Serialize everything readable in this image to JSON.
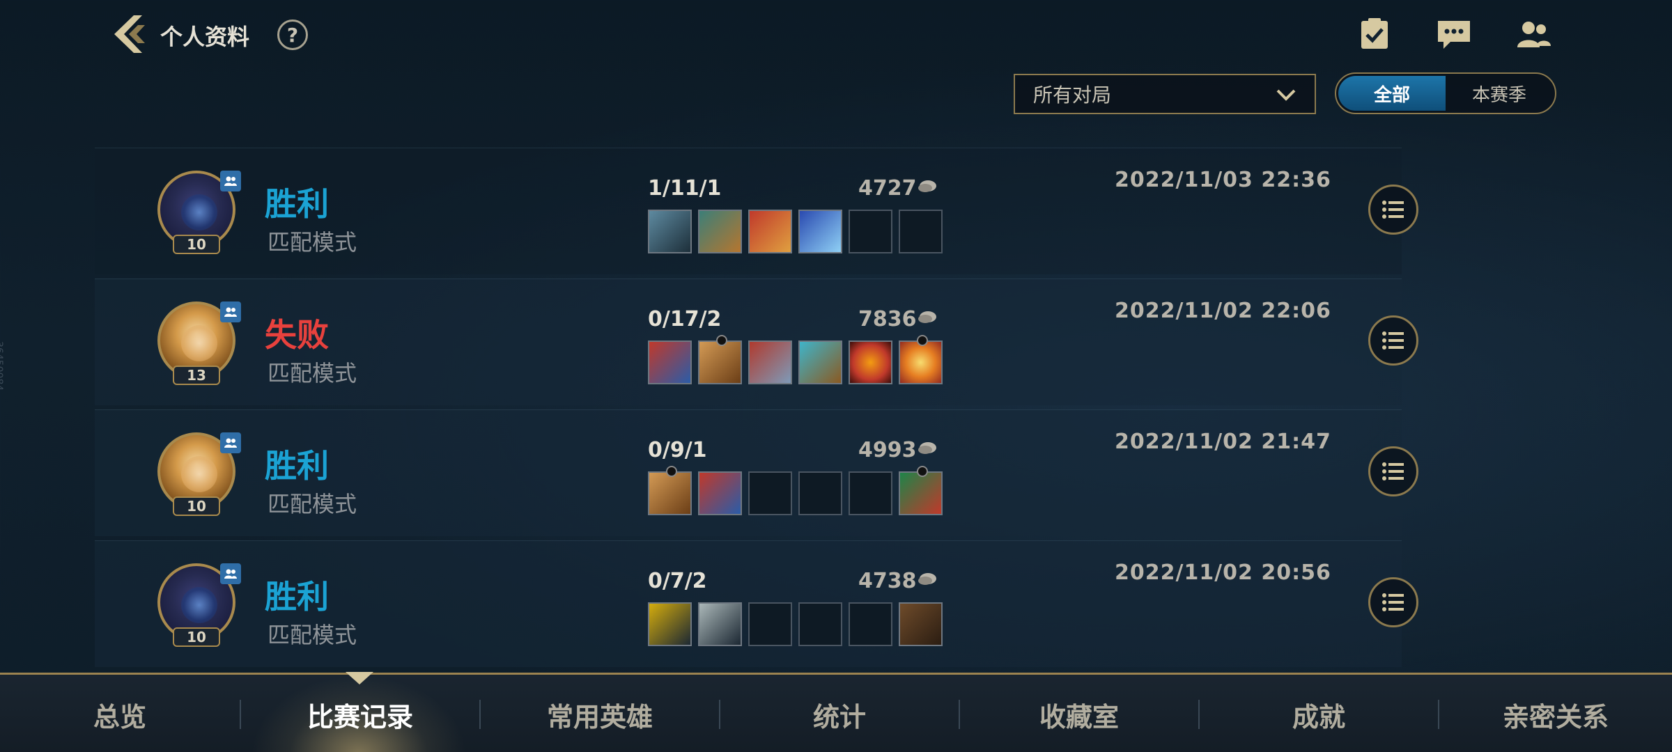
{
  "header": {
    "title": "个人资料",
    "help_label": "?",
    "icons": [
      "checklist-icon",
      "chat-icon",
      "friends-icon"
    ]
  },
  "filters": {
    "mode_select_value": "所有对局",
    "toggle": [
      {
        "label": "全部",
        "active": true
      },
      {
        "label": "本赛季",
        "active": false
      }
    ]
  },
  "side_id": "36450084",
  "matches": [
    {
      "result": "胜利",
      "result_type": "win",
      "mode": "匹配模式",
      "level": "10",
      "hero": "hero-a",
      "kda": "1/11/1",
      "gold": "4727",
      "time": "2022/11/03 22:36",
      "items": [
        "sword-item",
        "axe-item",
        "blade-item",
        "crystal-sword-item",
        "",
        ""
      ]
    },
    {
      "result": "失败",
      "result_type": "loss",
      "mode": "匹配模式",
      "level": "13",
      "hero": "hero-b",
      "kda": "0/17/2",
      "gold": "7836",
      "time": "2022/11/02 22:06",
      "items": [
        "shield-item",
        "buckler-item",
        "wings-item",
        "armor-item",
        "potion-item",
        "star-item"
      ]
    },
    {
      "result": "胜利",
      "result_type": "win",
      "mode": "匹配模式",
      "level": "10",
      "hero": "hero-b",
      "kda": "0/9/1",
      "gold": "4993",
      "time": "2022/11/02 21:47",
      "items": [
        "buckler-item",
        "shield-item",
        "",
        "",
        "",
        "boots-item"
      ]
    },
    {
      "result": "胜利",
      "result_type": "win",
      "mode": "匹配模式",
      "level": "10",
      "hero": "hero-a",
      "kda": "0/7/2",
      "gold": "4738",
      "time": "2022/11/02 20:56",
      "items": [
        "emblem-item",
        "dagger-item",
        "",
        "",
        "",
        "leather-boots-item"
      ]
    }
  ],
  "colors": {
    "win": "#1ba3d4",
    "loss": "#e8413d",
    "gold_border": "#8c7a4e",
    "active_tab": "#1d75a9"
  },
  "bottom_nav": [
    {
      "label": "总览",
      "active": false
    },
    {
      "label": "比赛记录",
      "active": true
    },
    {
      "label": "常用英雄",
      "active": false
    },
    {
      "label": "统计",
      "active": false
    },
    {
      "label": "收藏室",
      "active": false
    },
    {
      "label": "成就",
      "active": false
    },
    {
      "label": "亲密关系",
      "active": false
    }
  ]
}
